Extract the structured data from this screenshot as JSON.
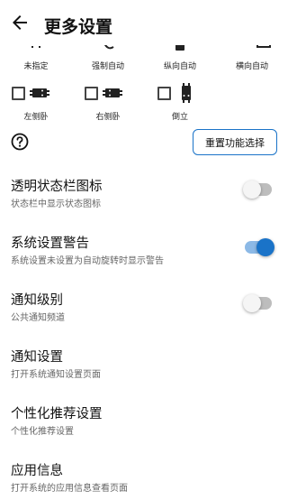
{
  "appbar": {
    "title": "更多设置"
  },
  "orientations_row1": [
    {
      "label": "未指定",
      "icon": "unspecified-icon"
    },
    {
      "label": "强制自动",
      "icon": "force-auto-icon"
    },
    {
      "label": "纵向自动",
      "icon": "portrait-auto-icon"
    },
    {
      "label": "横向自动",
      "icon": "landscape-auto-icon"
    }
  ],
  "orientations_row2": [
    {
      "label": "左侧卧",
      "icon": "phone-left-icon",
      "checked": false
    },
    {
      "label": "右侧卧",
      "icon": "phone-right-icon",
      "checked": false
    },
    {
      "label": "倒立",
      "icon": "phone-upside-down-icon",
      "checked": false
    }
  ],
  "reset_button": "重置功能选择",
  "settings": [
    {
      "title": "透明状态栏图标",
      "subtitle": "状态栏中显示状态图标",
      "toggle": true,
      "on": false
    },
    {
      "title": "系统设置警告",
      "subtitle": "系统设置未设置为自动旋转时显示警告",
      "toggle": true,
      "on": true
    },
    {
      "title": "通知级别",
      "subtitle": "公共通知频道",
      "toggle": true,
      "on": false
    },
    {
      "title": "通知设置",
      "subtitle": "打开系统通知设置页面",
      "toggle": false
    },
    {
      "title": "个性化推荐设置",
      "subtitle": "个性化推荐设置",
      "toggle": false
    },
    {
      "title": "应用信息",
      "subtitle": "打开系统的应用信息查看页面",
      "toggle": false
    }
  ],
  "colors": {
    "accent": "#1a73c8",
    "track_on": "#8cb9e6",
    "track_off": "#bdbdbd"
  }
}
